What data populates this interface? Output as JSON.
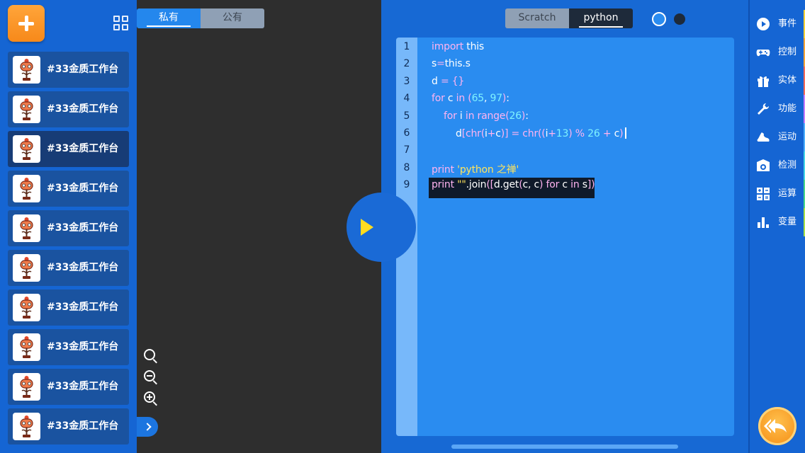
{
  "left_panel": {
    "sprites": [
      {
        "name": "#33金质工作台",
        "selected": false
      },
      {
        "name": "#33金质工作台",
        "selected": false
      },
      {
        "name": "#33金质工作台",
        "selected": true
      },
      {
        "name": "#33金质工作台",
        "selected": false
      },
      {
        "name": "#33金质工作台",
        "selected": false
      },
      {
        "name": "#33金质工作台",
        "selected": false
      },
      {
        "name": "#33金质工作台",
        "selected": false
      },
      {
        "name": "#33金质工作台",
        "selected": false
      },
      {
        "name": "#33金质工作台",
        "selected": false
      },
      {
        "name": "#33金质工作台",
        "selected": false
      }
    ]
  },
  "stage": {
    "tabs": {
      "private": "私有",
      "public": "公有"
    },
    "active_tab": "private"
  },
  "code_panel": {
    "tabs": {
      "scratch": "Scratch",
      "python": "python"
    },
    "active_tab": "python",
    "line_numbers": [
      "1",
      "2",
      "3",
      "4",
      "5",
      "6",
      "7",
      "8",
      "9"
    ],
    "lines": [
      "import this",
      "s=this.s",
      "d = {}",
      "for c in (65, 97):",
      "    for i in range(26):",
      "        d[chr(i+c)] = chr((i+13) % 26 + c)",
      "",
      "print 'python 之禅'",
      "print \"\".join([d.get(c, c) for c in s])"
    ],
    "highlighted_line": 9
  },
  "categories": [
    {
      "label": "事件",
      "icon": "play-circle-icon",
      "color": "#ffd23a"
    },
    {
      "label": "控制",
      "icon": "gamepad-icon",
      "color": "#ffa63a"
    },
    {
      "label": "实体",
      "icon": "gift-icon",
      "color": "#ff6b5a"
    },
    {
      "label": "功能",
      "icon": "wrench-icon",
      "color": "#c77dff"
    },
    {
      "label": "运动",
      "icon": "shoe-icon",
      "color": "#4fb0ff"
    },
    {
      "label": "检测",
      "icon": "detect-icon",
      "color": "#45d6e6"
    },
    {
      "label": "运算",
      "icon": "operator-grid-icon",
      "color": "#47d88a"
    },
    {
      "label": "变量",
      "icon": "bar-chart-icon",
      "color": "#a6e04a"
    }
  ]
}
